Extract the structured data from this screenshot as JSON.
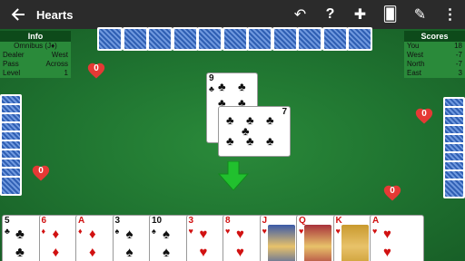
{
  "appbar": {
    "title": "Hearts",
    "back_icon": "arrow-left-icon",
    "actions": [
      "undo-icon",
      "help-icon",
      "gamepad-icon",
      "cards-icon",
      "scoresheet-icon",
      "more-vert-icon"
    ],
    "action_glyphs": [
      "↶",
      "?",
      "✚",
      "🂠",
      "✎",
      "⋮"
    ]
  },
  "info": {
    "header": "Info",
    "player": "Omnibus (J♦)",
    "rows": [
      {
        "label": "Dealer",
        "value": "West"
      },
      {
        "label": "Pass",
        "value": "Across"
      },
      {
        "label": "Level",
        "value": "1"
      }
    ]
  },
  "scores": {
    "header": "Scores",
    "rows": [
      {
        "name": "You",
        "value": "18"
      },
      {
        "name": "West",
        "value": "-7"
      },
      {
        "name": "North",
        "value": "-7"
      },
      {
        "name": "East",
        "value": "3"
      }
    ]
  },
  "hearts_taken": {
    "north": "0",
    "west": "0",
    "east": "0",
    "you": "0"
  },
  "trick": [
    {
      "rank": "9",
      "suit": "♣",
      "color": "#111111"
    },
    {
      "rank": "7",
      "suit": "♣",
      "color": "#111111"
    }
  ],
  "hand": [
    {
      "rank": "5",
      "suit": "♣",
      "color": "#111111"
    },
    {
      "rank": "6",
      "suit": "♦",
      "color": "#d11111"
    },
    {
      "rank": "A",
      "suit": "♦",
      "color": "#d11111"
    },
    {
      "rank": "3",
      "suit": "♠",
      "color": "#111111"
    },
    {
      "rank": "10",
      "suit": "♠",
      "color": "#111111"
    },
    {
      "rank": "3",
      "suit": "♥",
      "color": "#d11111"
    },
    {
      "rank": "8",
      "suit": "♥",
      "color": "#d11111"
    },
    {
      "rank": "J",
      "suit": "♥",
      "color": "#d11111"
    },
    {
      "rank": "Q",
      "suit": "♥",
      "color": "#d11111"
    },
    {
      "rank": "K",
      "suit": "♥",
      "color": "#d11111"
    },
    {
      "rank": "A",
      "suit": "♥",
      "color": "#d11111"
    }
  ],
  "colors": {
    "felt": "#1f7330",
    "appbar": "#2b2b2b",
    "card_back": "#2f5fb3",
    "heart": "#e53935",
    "arrow": "#21c02e"
  }
}
